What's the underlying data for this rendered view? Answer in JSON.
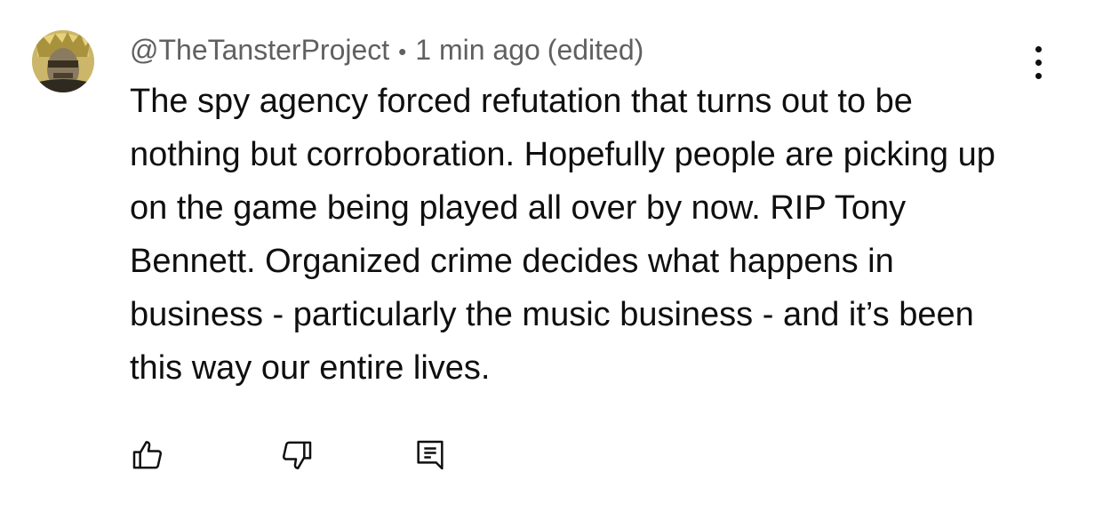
{
  "comment": {
    "author": "@TheTansterProject",
    "separator": "•",
    "timestamp": "1 min ago",
    "edited_label": "(edited)",
    "text": "The spy agency forced refutation that turns out to be nothing but corroboration. Hopefully people are picking up on the game being played all over by now. RIP Tony Bennett. Organized crime decides what happens in business - particularly the music business - and it’s been this way our entire lives."
  },
  "actions": {
    "menu_icon": "more-vertical-icon",
    "like_icon": "thumbs-up-icon",
    "dislike_icon": "thumbs-down-icon",
    "reply_icon": "reply-comment-icon"
  },
  "colors": {
    "text": "#0f0f0f",
    "meta": "#606060",
    "background": "#ffffff"
  }
}
